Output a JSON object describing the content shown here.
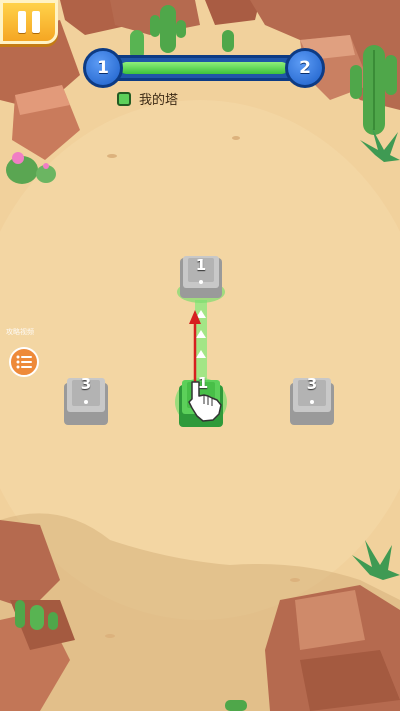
{
  "hud": {
    "level_current": "1",
    "level_next": "2",
    "progress": 1.0,
    "legend_label": "我的塔",
    "legend_color": "#5cd05a"
  },
  "side_menu": {
    "caption": "攻略视频"
  },
  "towers": [
    {
      "id": "top",
      "count": "1",
      "owner": "neutral"
    },
    {
      "id": "left",
      "count": "3",
      "owner": "neutral"
    },
    {
      "id": "center",
      "count": "1",
      "owner": "player"
    },
    {
      "id": "right",
      "count": "3",
      "owner": "neutral"
    }
  ],
  "colors": {
    "sand": "#f1d19c",
    "player": "#5cd05a",
    "neutral": "#a7a7a7",
    "arrow": "#d61f1f",
    "pause_button": "#f5a623",
    "progress_frame": "#1f56a8"
  },
  "icons": {
    "pause": "pause-icon",
    "menu": "list-icon",
    "tutorial_hand": "pointing-hand-icon"
  }
}
